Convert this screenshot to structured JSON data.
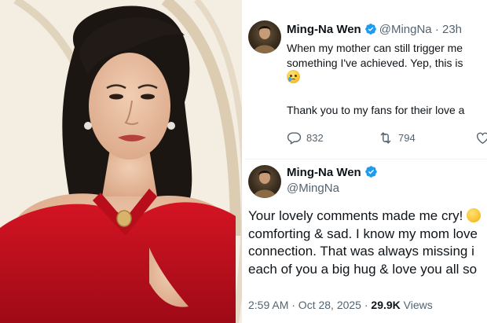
{
  "photo": {
    "alt": "Woman with dark hair wearing a red halter dress"
  },
  "tweet1": {
    "name": "Ming-Na Wen",
    "handle": "@MingNa",
    "time": "· 23h",
    "lines": [
      "When my mother can still trigger me",
      "something I've achieved. Yep, this is"
    ],
    "emoji": "crying-face-emoji",
    "thanks": "Thank you to my fans for their love a",
    "reply_count": "832",
    "retweet_count": "794"
  },
  "tweet2": {
    "name": "Ming-Na Wen",
    "handle": "@MingNa",
    "lines": [
      "Your lovely comments made me cry!",
      "comforting & sad. I know my mom love",
      "connection. That was always missing i",
      "each of you a big hug & love you all so"
    ],
    "emoji": "laughing-face-emoji",
    "timestamp": "2:59 AM · Oct 28, 2025 ·",
    "views_count": "29.9K",
    "views_label": "Views"
  },
  "colors": {
    "verified": "#1d9bf0",
    "secondary_text": "#536471",
    "primary_text": "#0f1419",
    "dress_red": "#c8101e"
  }
}
